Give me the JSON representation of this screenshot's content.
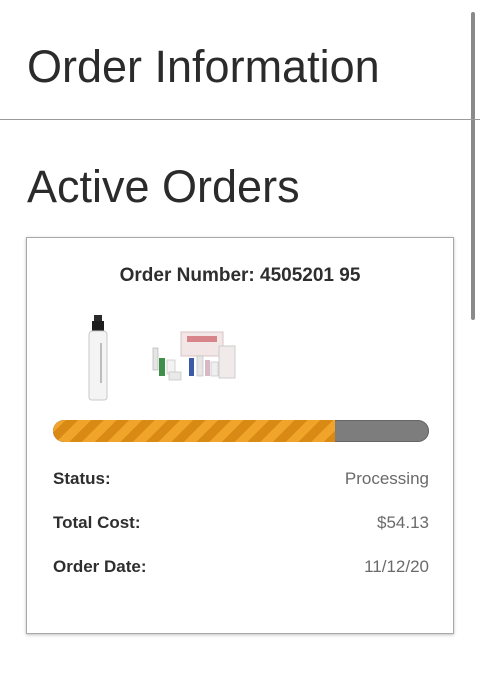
{
  "header": {
    "title": "Order Information"
  },
  "active_orders": {
    "section_title": "Active Orders",
    "orders": [
      {
        "order_number_text": "Order Number: 4505201 95",
        "products": [
          {
            "icon": "spray-bottle-product-image"
          },
          {
            "icon": "skincare-kit-product-image"
          }
        ],
        "progress": 0.75,
        "progress_colors": {
          "fill": "#f0a42a",
          "stripe": "#d88a14",
          "track": "#7d7d7d"
        },
        "status_label": "Status:",
        "status_value": "Processing",
        "total_cost_label": "Total Cost:",
        "total_cost_value": "$54.13",
        "order_date_label": "Order Date:",
        "order_date_value": "11/12/20"
      }
    ]
  }
}
